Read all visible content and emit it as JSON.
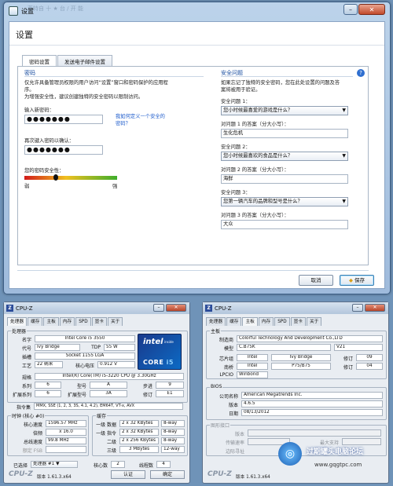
{
  "window": {
    "title": "设置",
    "behind_title": "莱特自 十 ★ 台 / 开 能"
  },
  "dialog": {
    "header": "设置",
    "tabs": [
      "密码设置",
      "发送电子邮件设置"
    ],
    "password": {
      "section": "密码",
      "desc1": "仅允许具备管理员权限的用户访问“设置”窗口和密码保护的应用程",
      "desc2": "序。",
      "desc3": "为增强安全性，建议创建独特的安全密码以限制访问。",
      "new_label": "输入新密码：",
      "new_value": "●●●●●●●",
      "link": "我如何定义一个安全的密码？",
      "confirm_label": "再次键入密码以确认：",
      "confirm_value": "●●●●●●●",
      "strength_label": "您的密码安全性：",
      "weak": "弱",
      "strong": "强",
      "strength": 0.33
    },
    "security": {
      "section": "安全问题",
      "desc1": "如果忘记了独特的安全密码，您在此处设置的问题及答",
      "desc2": "案将被用于验证。",
      "q1_label": "安全问题 1：",
      "q1_value": "您小时候最喜爱的游戏是什么？",
      "a1_label": "对问题 1 的答案（分大小写）：",
      "a1_value": "生化危机",
      "q2_label": "安全问题 2：",
      "q2_value": "您小时候最喜欢的食品是什么？",
      "a2_label": "对问题 2 的答案（分大小写）：",
      "a2_value": "海鲜",
      "q3_label": "安全问题 3：",
      "q3_value": "您第一辆汽车的品牌和型号是什么？",
      "a3_label": "对问题 3 的答案（分大小写）：",
      "a3_value": "大众"
    },
    "cancel": "取消",
    "save": "保存"
  },
  "cpuz1": {
    "title": "CPU-Z",
    "tabs": [
      "处理器",
      "缓存",
      "主板",
      "内存",
      "SPD",
      "显卡",
      "关于"
    ],
    "group_cpu": "处理器",
    "labels": {
      "name": "名字",
      "code": "代号",
      "tdp": "TDP",
      "socket": "插槽",
      "tech": "工艺",
      "voltage": "核心电压",
      "spec": "规格",
      "family": "系列",
      "model": "型号",
      "stepping": "步进",
      "ext_family": "扩展系列",
      "ext_model": "扩展型号",
      "revision": "修订",
      "instr": "指令集"
    },
    "values": {
      "name": "Intel Core i5 3550",
      "code": "Ivy Bridge",
      "tdp": "55 W",
      "socket": "Socket 1155 LGA",
      "tech": "22 纳米",
      "voltage": "0.912 V",
      "spec": "Intel(R) Core(TM) i5-3220 CPU @ 3.30GHz",
      "family": "6",
      "model": "A",
      "stepping": "9",
      "ext_family": "6",
      "ext_model": "3A",
      "revision": "E1",
      "instr": "MMX, SSE (1, 2, 3, 3S, 4.1, 4.2), EM64T, VT-x, AVX"
    },
    "logo": {
      "brand": "intel",
      "inside": "inside",
      "core": "CORE",
      "model": "i5"
    },
    "group_clock": "时钟 (核心 #0)",
    "clock_labels": [
      "核心速度",
      "倍频",
      "总线速度",
      "额定 FSB"
    ],
    "clock_values": [
      "1596.57 MHz",
      "x 16.0",
      "99.8 MHz",
      ""
    ],
    "group_cache": "缓存",
    "cache_labels": [
      "一级 数据",
      "一级 指令",
      "二级",
      "三级"
    ],
    "cache_values": [
      "2 x 32 KBytes",
      "2 x 32 KBytes",
      "2 x 256 KBytes",
      "3 MBytes"
    ],
    "cache_ways": [
      "8-way",
      "8-way",
      "8-way",
      "12-way"
    ],
    "selected_label": "已选择",
    "selected_value": "处理器 #1",
    "cores_label": "核心数",
    "cores_value": "2",
    "threads_label": "线程数",
    "threads_value": "4",
    "brand": "CPU-Z",
    "version": "版本 1.61.3.x64",
    "validate": "认证",
    "ok": "确定"
  },
  "cpuz2": {
    "title": "CPU-Z",
    "tabs": [
      "处理器",
      "缓存",
      "主板",
      "内存",
      "SPD",
      "显卡",
      "关于"
    ],
    "group_mb": "主板",
    "mb_labels": {
      "maker": "制造商",
      "model": "模型",
      "chipset": "芯片组",
      "south": "南桥",
      "lpcio": "LPCIO"
    },
    "mb_values": {
      "maker": "Colorful Technology And Development Co.,LTD",
      "model": "C.B75K",
      "model_rev": "V21",
      "chipset_vendor": "Intel",
      "chipset_name": "Ivy Bridge",
      "chipset_rev": "09",
      "south_vendor": "Intel",
      "south_name": "P75/B75",
      "south_rev": "04",
      "lpcio": "Winbond"
    },
    "rev_label": "修订",
    "group_bios": "BIOS",
    "bios_labels": [
      "公司名称",
      "版本",
      "日期"
    ],
    "bios_values": [
      "American Megatrends Inc.",
      "4.6.5",
      "08/13/2012"
    ],
    "group_gfx": "图形接口",
    "gfx_labels": [
      "版本",
      "传输速率",
      "边际寻址"
    ],
    "gfx_max": "最大支持",
    "brand": "CPU-Z",
    "version": "版本 1.61.3.x64"
  },
  "watermark": {
    "text": "过期罐头电脑论坛",
    "url": "www.gqgtpc.com"
  }
}
